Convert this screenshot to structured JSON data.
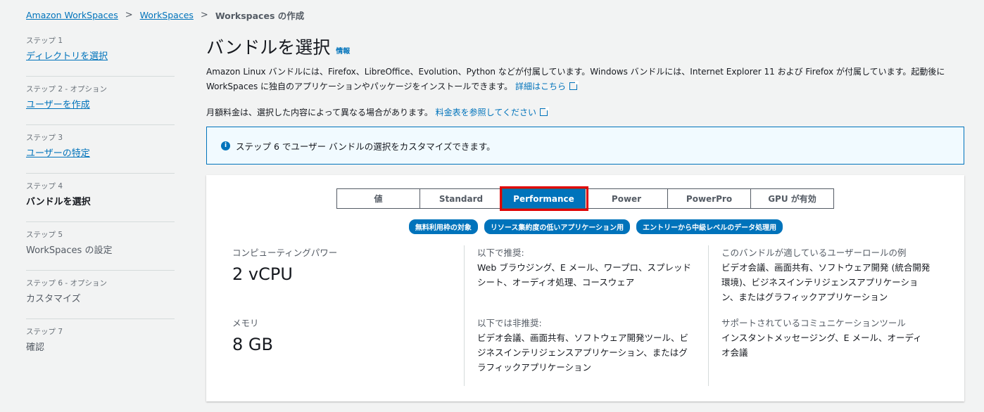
{
  "breadcrumb": {
    "items": [
      "Amazon WorkSpaces",
      "WorkSpaces"
    ],
    "current": "Workspaces の作成"
  },
  "steps": [
    {
      "num": "ステップ 1",
      "title": "ディレクトリを選択",
      "state": "link"
    },
    {
      "num": "ステップ 2 - オプション",
      "title": "ユーザーを作成",
      "state": "link"
    },
    {
      "num": "ステップ 3",
      "title": "ユーザーの特定",
      "state": "link"
    },
    {
      "num": "ステップ 4",
      "title": "バンドルを選択",
      "state": "active"
    },
    {
      "num": "ステップ 5",
      "title": "WorkSpaces の設定",
      "state": "muted"
    },
    {
      "num": "ステップ 6 - オプション",
      "title": "カスタマイズ",
      "state": "muted"
    },
    {
      "num": "ステップ 7",
      "title": "確認",
      "state": "muted"
    }
  ],
  "main": {
    "title": "バンドルを選択",
    "info_link": "情報",
    "desc_1": "Amazon Linux バンドルには、Firefox、LibreOffice、Evolution、Python などが付属しています。Windows バンドルには、Internet Explorer 11 および Firefox が付属しています。起動後に",
    "desc_2": "WorkSpaces に独自のアプリケーションやパッケージをインストールできます。",
    "desc_link": "詳細はこちら",
    "price_text": "月額料金は、選択した内容によって異なる場合があります。",
    "price_link": "料金表を参照してください",
    "info_box": "ステップ 6 でユーザー バンドルの選択をカスタマイズできます。"
  },
  "bundle_options": [
    {
      "label": "値",
      "selected": false
    },
    {
      "label": "Standard",
      "selected": false
    },
    {
      "label": "Performance",
      "selected": true
    },
    {
      "label": "Power",
      "selected": false
    },
    {
      "label": "PowerPro",
      "selected": false
    },
    {
      "label": "GPU が有効",
      "selected": false
    }
  ],
  "badges": [
    "無料利用枠の対象",
    "リソース集約度の低いアプリケーション用",
    "エントリーから中級レベルのデータ処理用"
  ],
  "details": {
    "compute_label": "コンピューティングパワー",
    "compute_value": "2 vCPU",
    "memory_label": "メモリ",
    "memory_value": "8 GB",
    "recommended_label": "以下で推奨:",
    "recommended_text": "Web ブラウジング、E メール、ワープロ、スプレッドシート、オーディオ処理、コースウェア",
    "not_recommended_label": "以下では非推奨:",
    "not_recommended_text": "ビデオ会議、画面共有、ソフトウェア開発ツール、ビジネスインテリジェンスアプリケーション、またはグラフィックアプリケーション",
    "roles_label": "このバンドルが適しているユーザーロールの例",
    "roles_text": "ビデオ会議、画面共有、ソフトウェア開発 (統合開発環境)、ビジネスインテリジェンスアプリケーション、またはグラフィックアプリケーション",
    "comm_label": "サポートされているコミュニケーションツール",
    "comm_text": "インスタントメッセージング、E メール、オーディオ会議"
  },
  "colors": {
    "accent": "#0073bb",
    "highlight": "#e00000",
    "background": "#f2f3f3"
  }
}
